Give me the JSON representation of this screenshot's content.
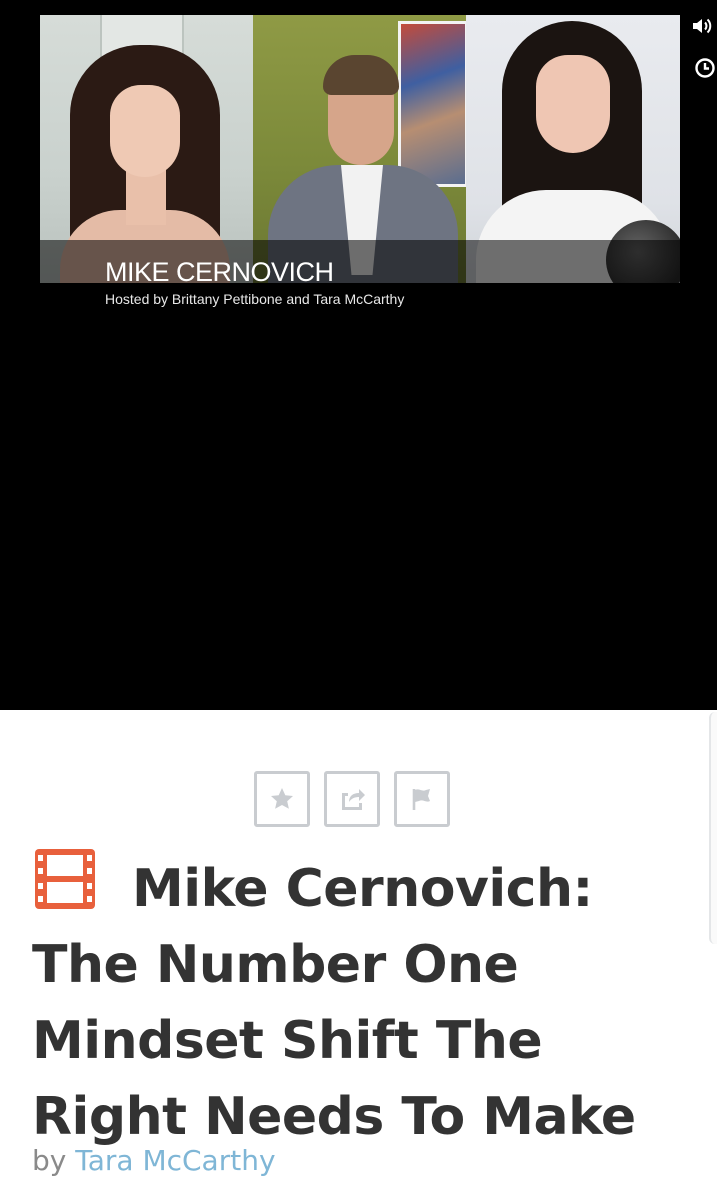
{
  "video": {
    "guest_name": "MIKE CERNOVICH",
    "hosted_by": "Hosted by Brittany Pettibone and Tara McCarthy"
  },
  "controls": {
    "volume_icon": "speaker-icon",
    "watch_later_icon": "clock-icon"
  },
  "actions": {
    "favorite_icon": "star-icon",
    "share_icon": "share-icon",
    "flag_icon": "flag-icon"
  },
  "article": {
    "type_icon": "film-strip-icon",
    "title": "Mike Cernovich: The Number One Mindset Shift The Right Needs To Make",
    "by_label": "by",
    "author": "Tara McCarthy"
  },
  "colors": {
    "icon_accent": "#e8603c",
    "author_link": "#7fb6d6",
    "title_text": "#333333",
    "button_border": "#c9ccd0"
  }
}
